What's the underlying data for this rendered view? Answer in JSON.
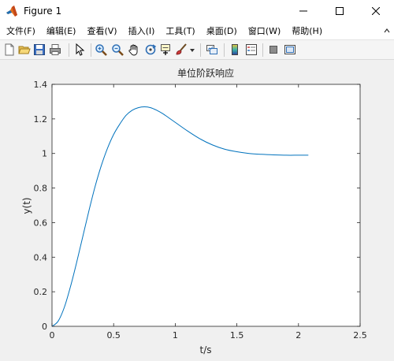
{
  "window": {
    "title": "Figure 1"
  },
  "menu": [
    {
      "label": "文件(F)",
      "name": "menu-file"
    },
    {
      "label": "编辑(E)",
      "name": "menu-edit"
    },
    {
      "label": "查看(V)",
      "name": "menu-view"
    },
    {
      "label": "插入(I)",
      "name": "menu-insert"
    },
    {
      "label": "工具(T)",
      "name": "menu-tools"
    },
    {
      "label": "桌面(D)",
      "name": "menu-desktop"
    },
    {
      "label": "窗口(W)",
      "name": "menu-window"
    },
    {
      "label": "帮助(H)",
      "name": "menu-help"
    }
  ],
  "toolbar": [
    "new-figure-icon",
    "open-file-icon",
    "save-icon",
    "print-icon",
    "select-arrow-icon",
    "zoom-in-icon",
    "zoom-out-icon",
    "pan-hand-icon",
    "rotate-3d-icon",
    "data-cursor-icon",
    "brush-icon",
    "brush-dropdown-icon",
    "link-plot-icon",
    "insert-colorbar-icon",
    "insert-legend-icon",
    "hide-plot-tools-icon",
    "show-plot-tools-icon"
  ],
  "colors": {
    "line": "#0072bd",
    "axes_bg": "#ffffff",
    "figure_bg": "#f0f0f0"
  },
  "chart_data": {
    "type": "line",
    "title": "单位阶跃响应",
    "xlabel": "t/s",
    "ylabel": "y(t)",
    "xlim": [
      0,
      2.5
    ],
    "ylim": [
      0,
      1.4
    ],
    "xticks": [
      "0",
      "0.5",
      "1",
      "1.5",
      "2",
      "2.5"
    ],
    "yticks": [
      "0",
      "0.2",
      "0.4",
      "0.6",
      "0.8",
      "1",
      "1.2",
      "1.4"
    ],
    "grid": false,
    "series": [
      {
        "x": [
          0,
          0.05,
          0.1,
          0.15,
          0.2,
          0.25,
          0.3,
          0.35,
          0.4,
          0.45,
          0.5,
          0.55,
          0.6,
          0.65,
          0.7,
          0.75,
          0.8,
          0.85,
          0.9,
          0.95,
          1.0,
          1.1,
          1.2,
          1.3,
          1.4,
          1.5,
          1.6,
          1.7,
          1.8,
          1.9,
          2.0,
          2.08
        ],
        "y": [
          0,
          0.03,
          0.11,
          0.23,
          0.37,
          0.52,
          0.67,
          0.81,
          0.93,
          1.03,
          1.11,
          1.17,
          1.22,
          1.25,
          1.265,
          1.27,
          1.265,
          1.25,
          1.23,
          1.205,
          1.18,
          1.13,
          1.085,
          1.05,
          1.025,
          1.01,
          1.0,
          0.995,
          0.992,
          0.99,
          0.99,
          0.99
        ]
      }
    ]
  }
}
